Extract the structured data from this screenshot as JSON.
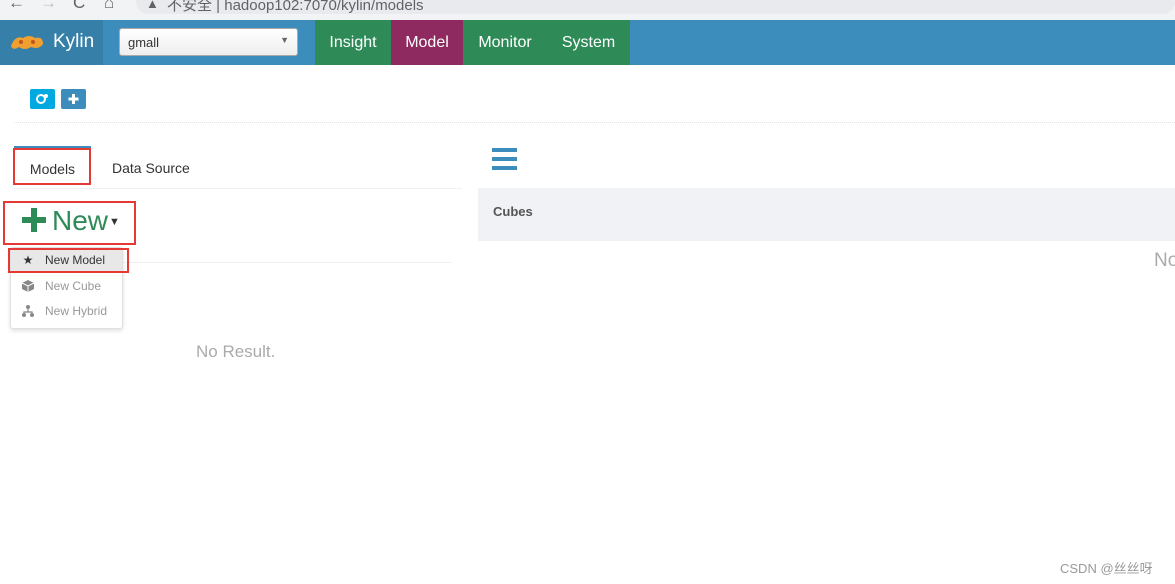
{
  "browser": {
    "back_glyph": "←",
    "forward_glyph": "→",
    "reload_glyph": "C",
    "home_glyph": "⌂",
    "warning_glyph": "▲",
    "url_text": "不安全 | hadoop102:7070/kylin/models"
  },
  "topnav": {
    "brand": "Kylin",
    "project": "gmall",
    "menu": [
      "Insight",
      "Model",
      "Monitor",
      "System"
    ],
    "active_menu": "Model",
    "colors": {
      "bar": "#3c8dbc",
      "menu": "#2e8b57",
      "active": "#8e2a60"
    }
  },
  "toolbar": {
    "icons": [
      "settings-icon",
      "plus-icon"
    ]
  },
  "left": {
    "tabs": [
      "Models",
      "Data Source"
    ],
    "new_button": "New",
    "dropdown": [
      {
        "label": "New Model",
        "icon": "star-icon"
      },
      {
        "label": "New Cube",
        "icon": "cube-icon"
      },
      {
        "label": "New Hybrid",
        "icon": "hybrid-icon"
      }
    ],
    "empty_text": "No Result."
  },
  "right": {
    "header": "Cubes",
    "empty_text_cropped": "No"
  },
  "watermark": "CSDN @丝丝呀"
}
